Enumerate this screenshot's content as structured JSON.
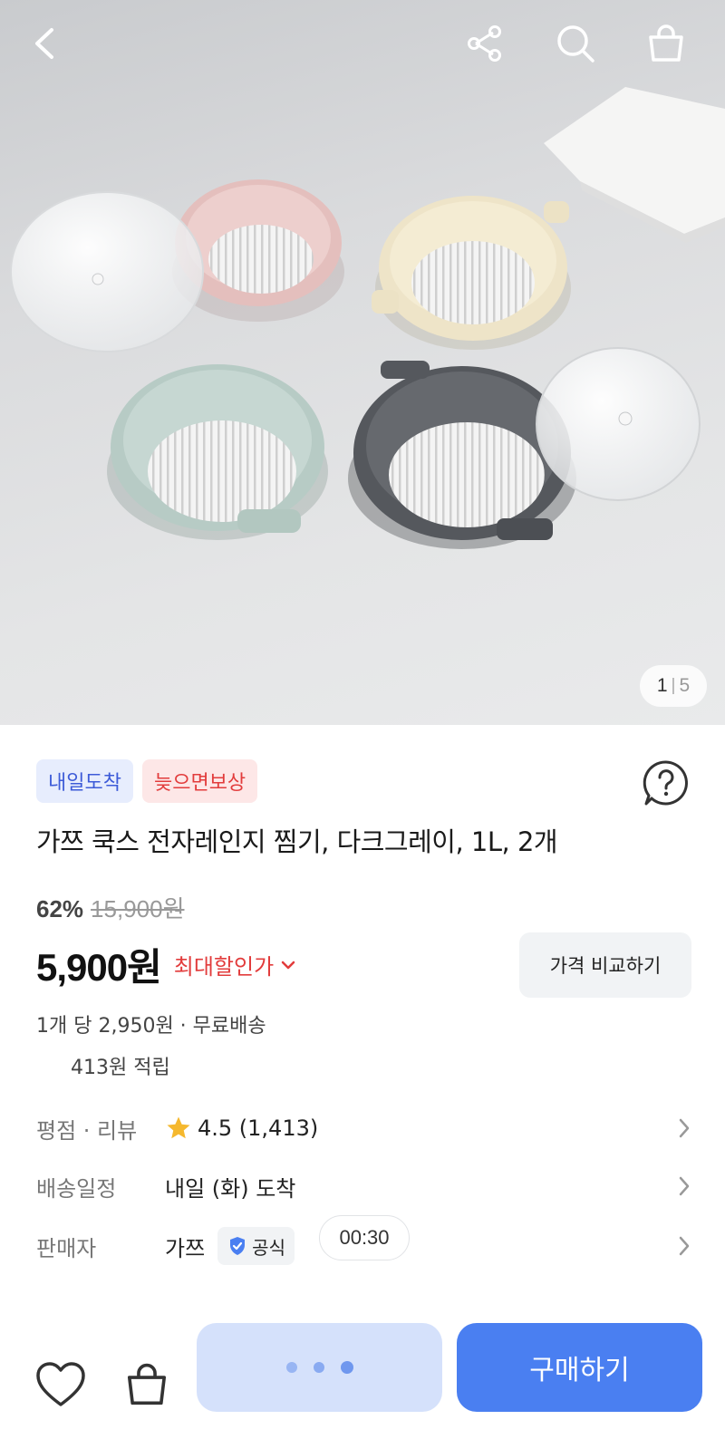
{
  "gallery": {
    "current_index": "1",
    "separator": "|",
    "total": "5"
  },
  "header_icons": {
    "back": "chevron-left-icon",
    "share": "share-icon",
    "search": "search-icon",
    "cart": "shopping-bag-icon"
  },
  "badges": [
    "내일도착",
    "늦으면보상"
  ],
  "product": {
    "title": "가쯔 쿡스 전자레인지 찜기, 다크그레이, 1L, 2개",
    "discount_rate": "62%",
    "original_price": "15,900원",
    "sale_price": "5,900원",
    "max_discount_label": "최대할인가",
    "compare_label": "가격 비교하기",
    "unit_info": "1개 당 2,950원 · 무료배송",
    "points": "413원 적립"
  },
  "info": {
    "rating_label": "평점 · 리뷰",
    "rating_value": "4.5 (1,413)",
    "delivery_label": "배송일정",
    "delivery_value": "내일 (화) 도착",
    "seller_label": "판매자",
    "seller_value": "가쯔",
    "official_label": "공식"
  },
  "timer": "00:30",
  "bottom_bar": {
    "buy_label": "구매하기",
    "wishlist_icon": "heart-icon",
    "cart_icon": "shopping-bag-icon"
  },
  "colors": {
    "accent": "#4a7ff1",
    "accent_light": "#d5e1fb",
    "sale_red": "#e23c3c",
    "badge_blue_text": "#3d5bd8",
    "star": "#f5b82e"
  }
}
